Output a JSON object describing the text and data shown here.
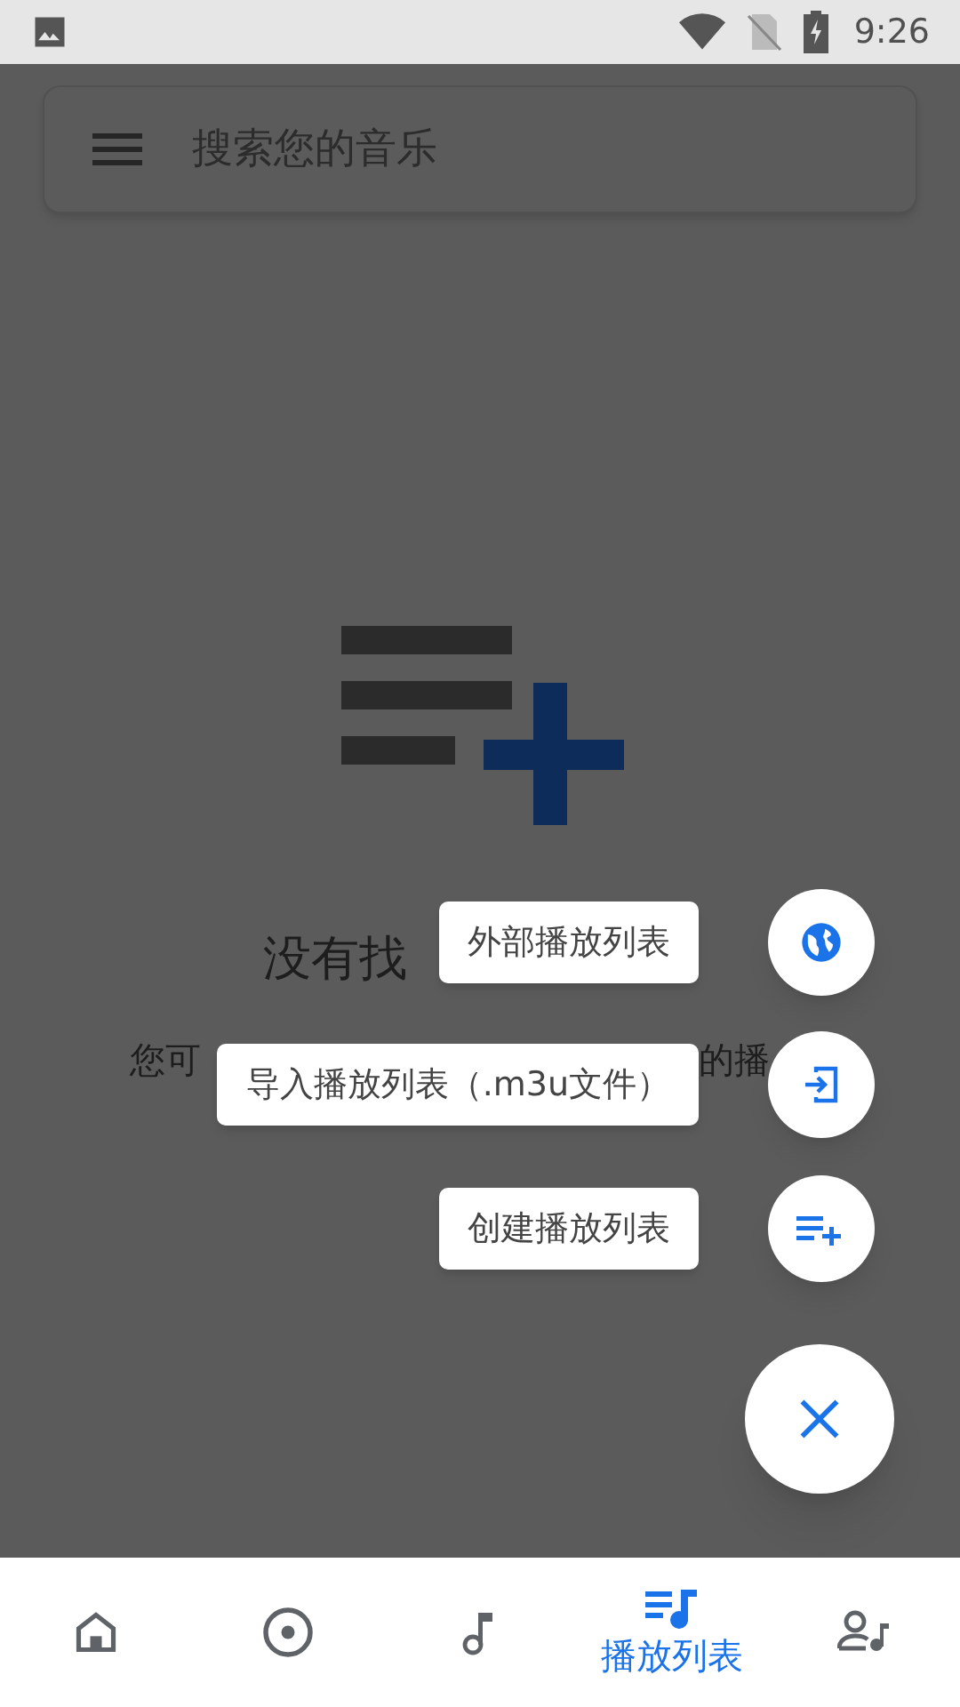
{
  "status_bar": {
    "time": "9:26"
  },
  "search": {
    "placeholder": "搜索您的音乐"
  },
  "empty_state": {
    "title": "没有找",
    "description_fragments": [
      "您可",
      "的播"
    ]
  },
  "speed_dial": {
    "expanded": true,
    "actions": [
      {
        "kind": "globe",
        "label": "外部播放列表"
      },
      {
        "kind": "import",
        "label": "导入播放列表（.m3u文件）"
      },
      {
        "kind": "add",
        "label": "创建播放列表"
      }
    ]
  },
  "bottom_nav": [
    {
      "kind": "home",
      "selected": false
    },
    {
      "kind": "album",
      "selected": false
    },
    {
      "kind": "song",
      "selected": false
    },
    {
      "kind": "playlist",
      "selected": true,
      "label": "播放列表"
    },
    {
      "kind": "artist",
      "selected": false
    }
  ]
}
